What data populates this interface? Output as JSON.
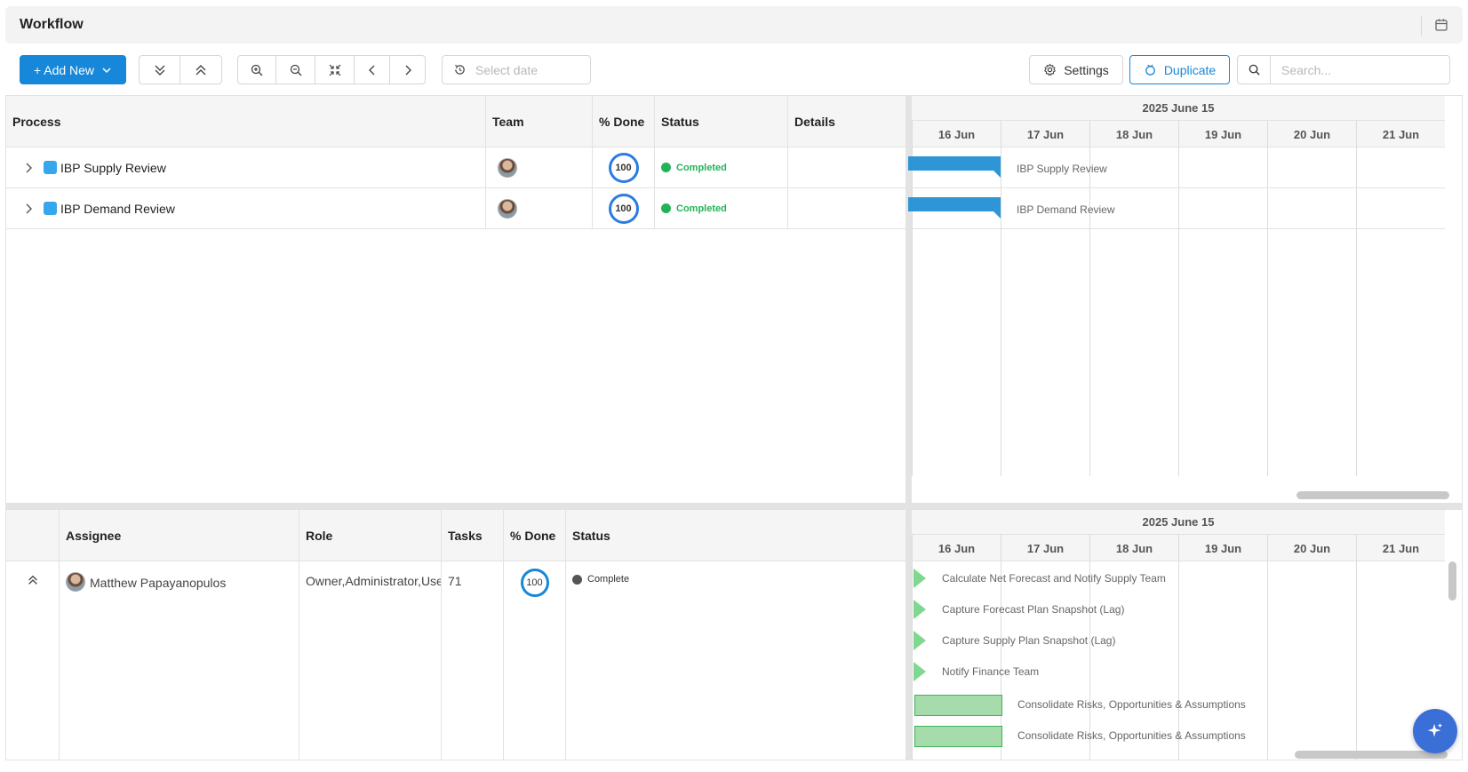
{
  "app": {
    "title": "Workflow"
  },
  "toolbar": {
    "add_new_label": "+ Add New",
    "date_placeholder": "Select date",
    "settings_label": "Settings",
    "duplicate_label": "Duplicate",
    "search_placeholder": "Search..."
  },
  "process_grid": {
    "columns": {
      "process": "Process",
      "team": "Team",
      "done": "% Done",
      "status": "Status",
      "details": "Details"
    },
    "rows": [
      {
        "name": "IBP Supply Review",
        "done": "100",
        "status": "Completed"
      },
      {
        "name": "IBP Demand Review",
        "done": "100",
        "status": "Completed"
      }
    ]
  },
  "gantt_top": {
    "week_label": "2025 June 15",
    "days": [
      "16 Jun",
      "17 Jun",
      "18 Jun",
      "19 Jun",
      "20 Jun",
      "21 Jun"
    ],
    "bars": [
      {
        "label": "IBP Supply Review"
      },
      {
        "label": "IBP Demand Review"
      }
    ]
  },
  "assignee_grid": {
    "columns": {
      "assignee": "Assignee",
      "role": "Role",
      "tasks": "Tasks",
      "done": "% Done",
      "status": "Status"
    },
    "rows": [
      {
        "name": "Matthew Papayanopulos",
        "role": "Owner,Administrator,Use",
        "tasks": "71",
        "done": "100",
        "status": "Complete"
      }
    ]
  },
  "gantt_bottom": {
    "week_label": "2025 June 15",
    "days": [
      "16 Jun",
      "17 Jun",
      "18 Jun",
      "19 Jun",
      "20 Jun",
      "21 Jun"
    ],
    "tasks": [
      {
        "label": "Calculate Net Forecast and Notify Supply Team",
        "kind": "milestone"
      },
      {
        "label": "Capture Forecast Plan Snapshot (Lag)",
        "kind": "milestone"
      },
      {
        "label": "Capture Supply Plan Snapshot (Lag)",
        "kind": "milestone"
      },
      {
        "label": "Notify Finance Team",
        "kind": "milestone"
      },
      {
        "label": "Consolidate Risks, Opportunities & Assumptions",
        "kind": "bar"
      },
      {
        "label": "Consolidate Risks, Opportunities & Assumptions",
        "kind": "bar"
      }
    ]
  },
  "colors": {
    "primary": "#1687d9",
    "completed_green": "#22b35a",
    "gantt_bar_blue": "#2e96d6",
    "milestone_green": "#7fd88f",
    "status_grey": "#555555"
  }
}
